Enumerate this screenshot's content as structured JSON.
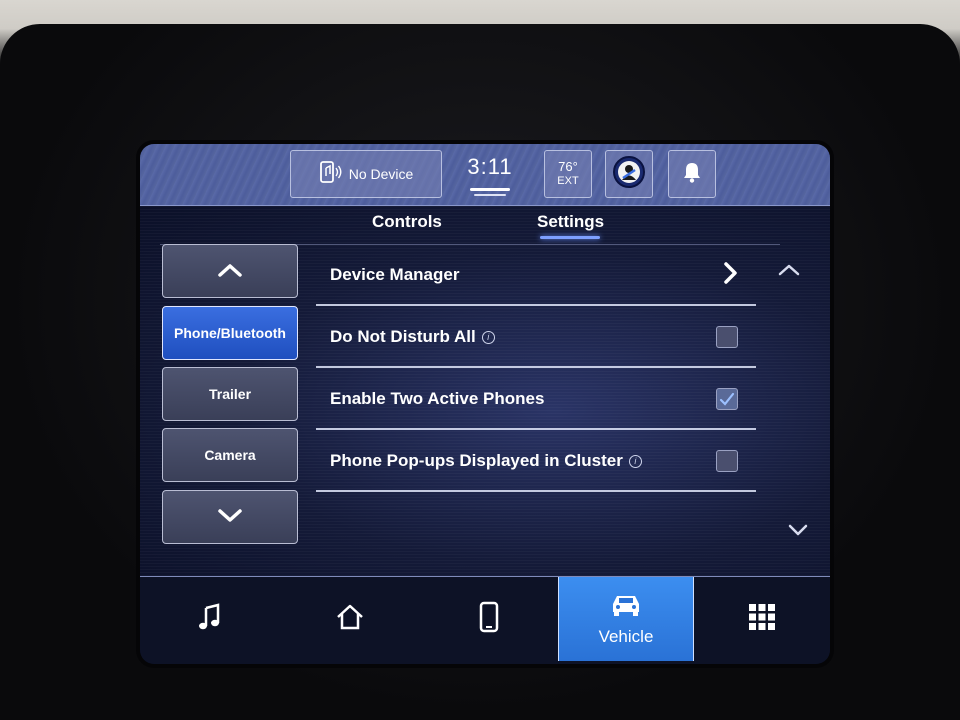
{
  "status_bar": {
    "device": "No Device",
    "clock": "3:11",
    "temperature": "76°",
    "temperature_unit": "EXT"
  },
  "tabs": [
    {
      "label": "Controls",
      "active": false
    },
    {
      "label": "Settings",
      "active": true
    }
  ],
  "nav": {
    "items": [
      {
        "label": "Phone/Bluetooth",
        "active": true
      },
      {
        "label": "Trailer",
        "active": false
      },
      {
        "label": "Camera",
        "active": false
      }
    ]
  },
  "settings": {
    "rows": [
      {
        "label": "Device Manager",
        "type": "link"
      },
      {
        "label": "Do Not Disturb All",
        "type": "checkbox",
        "checked": false,
        "info": true
      },
      {
        "label": "Enable Two Active Phones",
        "type": "checkbox",
        "checked": true,
        "info": false
      },
      {
        "label": "Phone Pop-ups Displayed in Cluster",
        "type": "checkbox",
        "checked": false,
        "info": true
      }
    ]
  },
  "dock": {
    "vehicle_label": "Vehicle"
  },
  "colors": {
    "accent": "#2a72d6",
    "active_nav": "#2f5fd0",
    "status_bar": "#56669f"
  },
  "icons": [
    "phone-audio-icon",
    "driver-icon",
    "bell-icon",
    "chevron-up-icon",
    "chevron-down-icon",
    "chevron-right-icon",
    "info-icon",
    "music-note-icon",
    "home-icon",
    "smartphone-icon",
    "car-icon",
    "apps-grid-icon"
  ]
}
